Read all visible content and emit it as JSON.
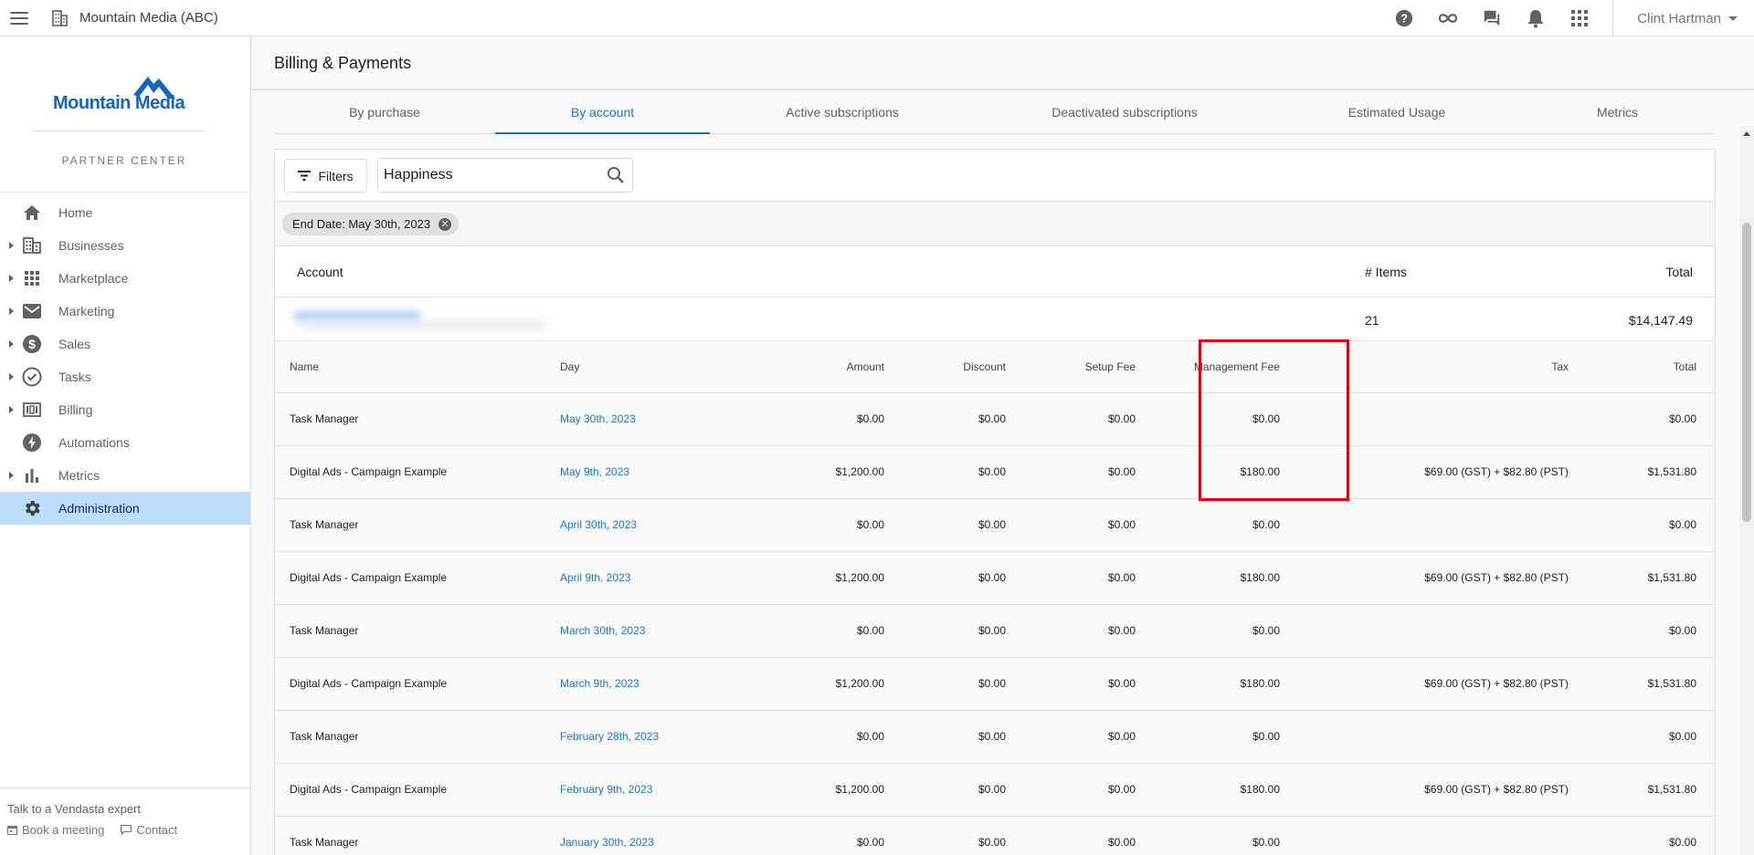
{
  "topbar": {
    "org_name": "Mountain Media (ABC)",
    "user_name": "Clint Hartman",
    "icons": [
      "help-icon",
      "infinity-icon",
      "chat-icon",
      "bell-icon",
      "apps-grid-icon"
    ]
  },
  "sidebar": {
    "brand_name": "Mountain Media",
    "brand_sub": "PARTNER CENTER",
    "items": [
      {
        "label": "Home",
        "icon": "home-icon",
        "expandable": false
      },
      {
        "label": "Businesses",
        "icon": "building-icon",
        "expandable": true
      },
      {
        "label": "Marketplace",
        "icon": "grid-icon",
        "expandable": true
      },
      {
        "label": "Marketing",
        "icon": "mail-icon",
        "expandable": true
      },
      {
        "label": "Sales",
        "icon": "dollar-icon",
        "expandable": true
      },
      {
        "label": "Tasks",
        "icon": "check-circle-icon",
        "expandable": true
      },
      {
        "label": "Billing",
        "icon": "billing-icon",
        "expandable": true
      },
      {
        "label": "Automations",
        "icon": "bolt-icon",
        "expandable": false
      },
      {
        "label": "Metrics",
        "icon": "bar-chart-icon",
        "expandable": true
      },
      {
        "label": "Administration",
        "icon": "gear-icon",
        "expandable": false,
        "active": true
      }
    ],
    "footer": {
      "title": "Talk to a Vendasta expert",
      "book": "Book a meeting",
      "contact": "Contact"
    }
  },
  "page": {
    "title": "Billing & Payments"
  },
  "tabs": [
    {
      "label": "By purchase",
      "active": false
    },
    {
      "label": "By account",
      "active": true
    },
    {
      "label": "Active subscriptions",
      "active": false
    },
    {
      "label": "Deactivated subscriptions",
      "active": false
    },
    {
      "label": "Estimated Usage",
      "active": false
    },
    {
      "label": "Metrics",
      "active": false
    }
  ],
  "toolbar": {
    "filters_label": "Filters",
    "search_value": "Happiness"
  },
  "chips": [
    {
      "label": "End Date: May 30th, 2023"
    }
  ],
  "account_table": {
    "headers": {
      "account": "Account",
      "items": "# Items",
      "total": "Total"
    },
    "row": {
      "items": "21",
      "total": "$14,147.49"
    }
  },
  "items_table": {
    "headers": {
      "name": "Name",
      "day": "Day",
      "amount": "Amount",
      "discount": "Discount",
      "setup_fee": "Setup Fee",
      "management_fee": "Management Fee",
      "tax": "Tax",
      "total": "Total"
    },
    "rows": [
      {
        "name": "Task Manager",
        "day": "May 30th, 2023",
        "amount": "$0.00",
        "discount": "$0.00",
        "setup_fee": "$0.00",
        "management_fee": "$0.00",
        "tax": "",
        "total": "$0.00"
      },
      {
        "name": "Digital Ads - Campaign Example",
        "day": "May 9th, 2023",
        "amount": "$1,200.00",
        "discount": "$0.00",
        "setup_fee": "$0.00",
        "management_fee": "$180.00",
        "tax": "$69.00 (GST) + $82.80 (PST)",
        "total": "$1,531.80"
      },
      {
        "name": "Task Manager",
        "day": "April 30th, 2023",
        "amount": "$0.00",
        "discount": "$0.00",
        "setup_fee": "$0.00",
        "management_fee": "$0.00",
        "tax": "",
        "total": "$0.00"
      },
      {
        "name": "Digital Ads - Campaign Example",
        "day": "April 9th, 2023",
        "amount": "$1,200.00",
        "discount": "$0.00",
        "setup_fee": "$0.00",
        "management_fee": "$180.00",
        "tax": "$69.00 (GST) + $82.80 (PST)",
        "total": "$1,531.80"
      },
      {
        "name": "Task Manager",
        "day": "March 30th, 2023",
        "amount": "$0.00",
        "discount": "$0.00",
        "setup_fee": "$0.00",
        "management_fee": "$0.00",
        "tax": "",
        "total": "$0.00"
      },
      {
        "name": "Digital Ads - Campaign Example",
        "day": "March 9th, 2023",
        "amount": "$1,200.00",
        "discount": "$0.00",
        "setup_fee": "$0.00",
        "management_fee": "$180.00",
        "tax": "$69.00 (GST) + $82.80 (PST)",
        "total": "$1,531.80"
      },
      {
        "name": "Task Manager",
        "day": "February 28th, 2023",
        "amount": "$0.00",
        "discount": "$0.00",
        "setup_fee": "$0.00",
        "management_fee": "$0.00",
        "tax": "",
        "total": "$0.00"
      },
      {
        "name": "Digital Ads - Campaign Example",
        "day": "February 9th, 2023",
        "amount": "$1,200.00",
        "discount": "$0.00",
        "setup_fee": "$0.00",
        "management_fee": "$180.00",
        "tax": "$69.00 (GST) + $82.80 (PST)",
        "total": "$1,531.80"
      },
      {
        "name": "Task Manager",
        "day": "January 30th, 2023",
        "amount": "$0.00",
        "discount": "$0.00",
        "setup_fee": "$0.00",
        "management_fee": "$0.00",
        "tax": "",
        "total": "$0.00"
      }
    ]
  },
  "colors": {
    "accent": "#1976d2",
    "active_nav_bg": "#bbdefb",
    "highlight_border": "#e3000f",
    "brand_blue": "#1565c0"
  }
}
